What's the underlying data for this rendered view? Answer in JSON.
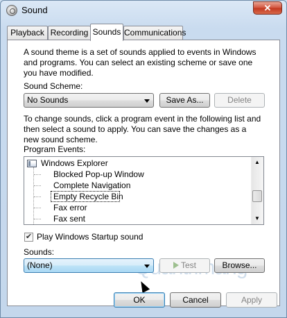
{
  "window": {
    "title": "Sound",
    "close_label": "✕",
    "icon": "speaker-icon"
  },
  "tabs": [
    {
      "label": "Playback",
      "active": false
    },
    {
      "label": "Recording",
      "active": false
    },
    {
      "label": "Sounds",
      "active": true
    },
    {
      "label": "Communications",
      "active": false
    }
  ],
  "sounds_tab": {
    "intro": "A sound theme is a set of sounds applied to events in Windows and programs.  You can select an existing scheme or save one you have modified.",
    "scheme_label": "Sound Scheme:",
    "scheme_value": "No Sounds",
    "save_as_label": "Save As...",
    "delete_label": "Delete",
    "change_text": "To change sounds, click a program event in the following list and then select a sound to apply.  You can save the changes as a new sound scheme.",
    "events_label": "Program Events:",
    "events": {
      "group": "Windows Explorer",
      "items": [
        "Blocked Pop-up Window",
        "Complete Navigation",
        "Empty Recycle Bin",
        "Fax error",
        "Fax sent"
      ],
      "selected_item": "Empty Recycle Bin"
    },
    "startup_label": "Play Windows Startup sound",
    "startup_checked": true,
    "sounds_label": "Sounds:",
    "sound_value": "(None)",
    "test_label": "Test",
    "browse_label": "Browse..."
  },
  "watermark": "Quantrimang",
  "footer": {
    "ok_label": "OK",
    "cancel_label": "Cancel",
    "apply_label": "Apply"
  }
}
